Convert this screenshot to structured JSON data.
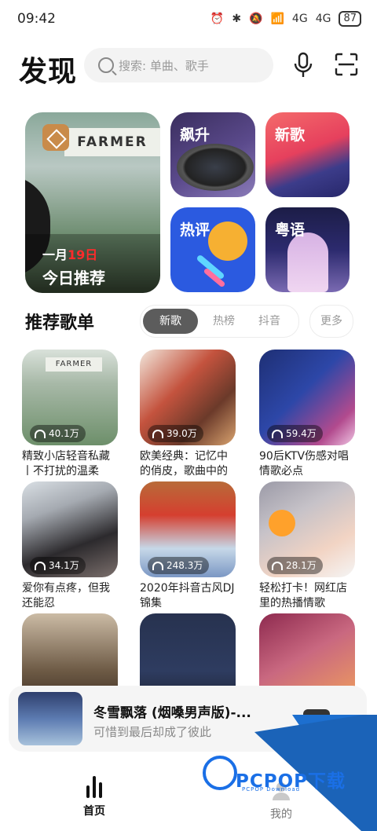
{
  "status_bar": {
    "time": "09:42",
    "battery": "87",
    "network_1": "4G",
    "network_2": "4G"
  },
  "header": {
    "title": "发现",
    "search_placeholder": "搜索: 单曲、歌手"
  },
  "featured": {
    "date_month": "一月",
    "date_day": "19日",
    "daily_label": "今日推荐",
    "shop_sign": "FARMER",
    "cards": [
      {
        "label": "飙升"
      },
      {
        "label": "新歌"
      },
      {
        "label": "热评"
      },
      {
        "label": "粤语"
      }
    ]
  },
  "section": {
    "title": "推荐歌单",
    "tabs": [
      "新歌",
      "热榜",
      "抖音"
    ],
    "active_tab": "新歌",
    "more": "更多"
  },
  "playlists": [
    {
      "plays": "40.1万",
      "name": "精致小店轻音私藏丨不打扰的温柔",
      "sign": "FARMER"
    },
    {
      "plays": "39.0万",
      "name": "欧美经典：记忆中的俏皮，歌曲中的"
    },
    {
      "plays": "59.4万",
      "name": "90后KTV伤感对唱情歌必点"
    },
    {
      "plays": "34.1万",
      "name": "爱你有点疼，但我还能忍"
    },
    {
      "plays": "248.3万",
      "name": "2020年抖音古风DJ锦集"
    },
    {
      "plays": "28.1万",
      "name": "轻松打卡！网红店里的热播情歌"
    },
    {
      "plays": "",
      "name": ""
    },
    {
      "plays": "",
      "name": ""
    },
    {
      "plays": "",
      "name": ""
    }
  ],
  "player": {
    "song": "冬雪飘落 (烟嗓男声版)-...",
    "lyric": "可惜到最后却成了彼此"
  },
  "nav": {
    "home": "首页",
    "me": "我的"
  },
  "watermark": {
    "brand": "PCPOP下载",
    "sub": "PCPOP Download"
  },
  "colors": {
    "accent_red": "#ff2b2b",
    "tab_active": "#5c5c5c",
    "watermark_blue": "#1a6fe6"
  }
}
